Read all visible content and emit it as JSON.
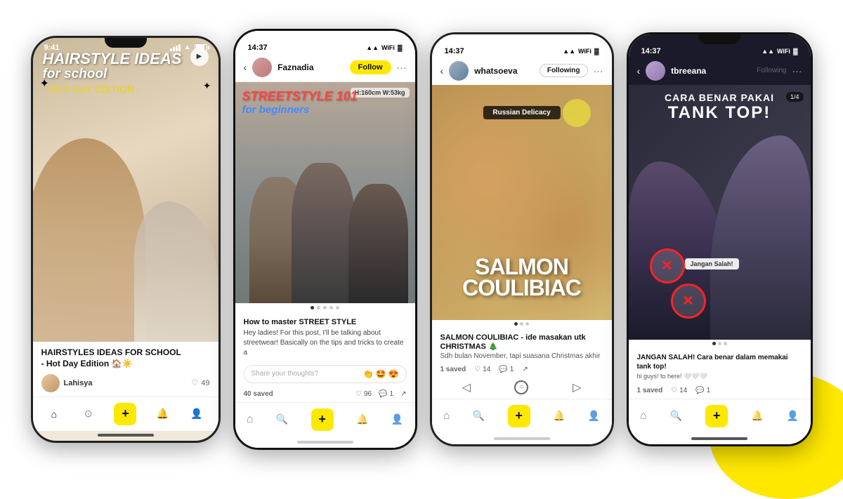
{
  "phones": {
    "phone1": {
      "status_time": "9:41",
      "content_title_line1": "HAIRSTYLE IDEAS",
      "content_title_line2": "for school",
      "content_title_line3": "· HOT DAY EDITION ·",
      "post_title": "HAIRSTYLES IDEAS FOR SCHOOL",
      "post_subtitle": "- Hot Day Edition 🏠☀️",
      "username": "Lahisya",
      "like_count": "49",
      "nav_home": "⌂",
      "nav_search": "⊙",
      "nav_add": "+",
      "nav_bell": "🔔",
      "nav_person": "👤"
    },
    "phone2": {
      "status_time": "14:37",
      "username": "Faznadia",
      "follow_label": "Follow",
      "height_info": "H:160cm W:53kg",
      "title_line1": "STREETSTYLE 101",
      "title_line2": "for beginners",
      "caption_title": "How to master STREET STYLE",
      "caption_text": "Hey ladies! For this post, I'll be talking about streetwear! Basically on the tips and tricks to create a",
      "comment_placeholder": "Share your thoughts?",
      "emoji_1": "👏",
      "emoji_2": "🤩",
      "emoji_3": "😍",
      "saves_count": "40 saved",
      "likes_count": "96",
      "comments_count": "1"
    },
    "phone3": {
      "status_time": "14:37",
      "username": "whatsoeva",
      "following_label": "Following",
      "russian_delicacy": "Russian Delicacy",
      "salmon_title_1": "SALMON",
      "salmon_title_2": "COULIBIAC",
      "caption_title": "SALMON COULIBIAC - ide masakan utk CHRISTMAS 🎄",
      "caption_text": "Sdh bulan November, tapi suasana Christmas akhir",
      "saves_count": "1 saved",
      "likes_count": "14",
      "comments_count": "1"
    },
    "phone4": {
      "status_time": "14:37",
      "username": "tbreeana",
      "following_label": "Following",
      "title_line1": "CARA BENAR PAKAI",
      "title_line2": "TANK TOP!",
      "page_badge": "1/4",
      "jangan_salah": "Jangan Salah!",
      "caption_title": "JANGAN SALAH! Cara benar dalam memakai tank top!",
      "caption_text": "hi guys! to here! 🤍🤍🤍",
      "saves_count": "1 saved",
      "likes_count": "14",
      "comments_count": "1"
    }
  },
  "colors": {
    "yellow": "#FFE800",
    "accent_red": "#FF4444",
    "accent_blue": "#4488FF"
  }
}
